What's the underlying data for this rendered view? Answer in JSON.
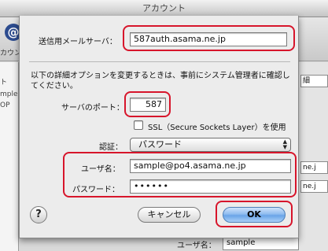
{
  "window": {
    "title": "アカウント"
  },
  "toolbar": {
    "icon_glyph": "@",
    "label": "カウン"
  },
  "sidebar": {
    "items": [
      "ト",
      "mple",
      "OP"
    ]
  },
  "right_panel": {
    "fields": [
      "細",
      "ne.j",
      "ne.j"
    ]
  },
  "background": {
    "username_label": "ユーザ名：",
    "username_value": "sample"
  },
  "dialog": {
    "smtp_server_label": "送信用メールサーバ：",
    "smtp_server_value": "587auth.asama.ne.jp",
    "note": "以下の詳細オプションを変更するときは、事前にシステム管理者に確認してください。",
    "port_label": "サーバのポート：",
    "port_value": "587",
    "ssl_label": "SSL（Secure Sockets Layer）を使用",
    "ssl_checked": false,
    "auth_label": "認証：",
    "auth_value": "パスワード",
    "username_label": "ユーザ名：",
    "username_value": "sample@po4.asama.ne.jp",
    "password_label": "パスワード：",
    "password_value": "••••••",
    "help_label": "?",
    "cancel_label": "キャンセル",
    "ok_label": "OK"
  },
  "colors": {
    "highlight": "#d7152b",
    "default_button": "#6aa4e8",
    "sheet_bg": "#ececec"
  }
}
